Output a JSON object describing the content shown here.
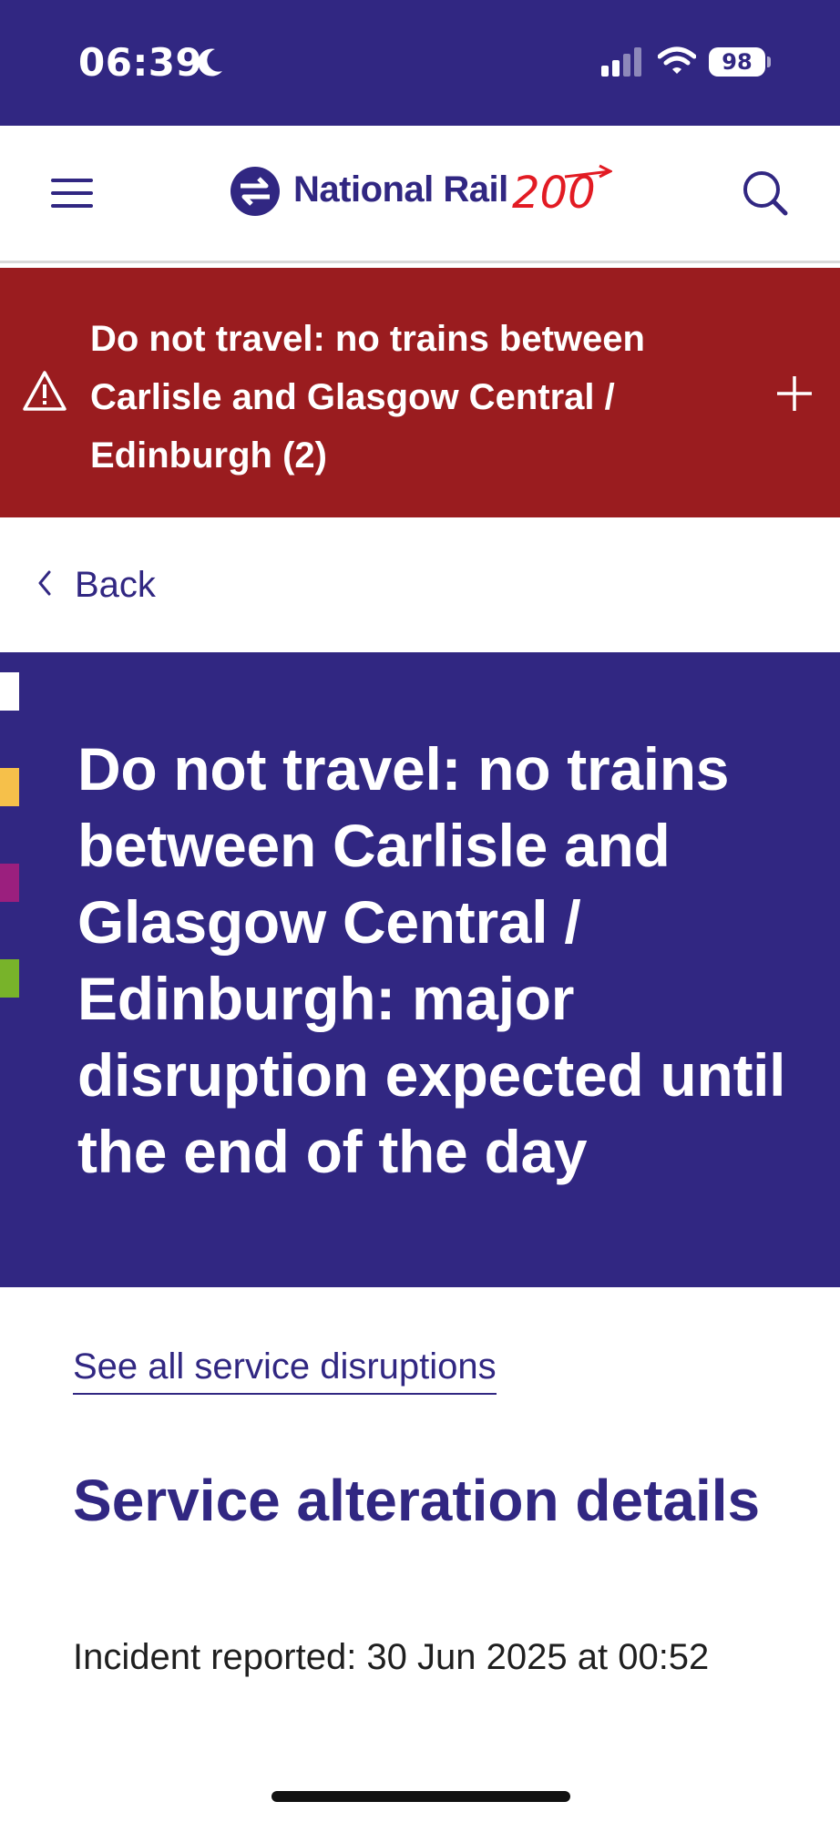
{
  "status_bar": {
    "time": "06:39",
    "battery": "98",
    "icons": [
      "moon-icon",
      "signal-icon",
      "wifi-icon",
      "battery-icon"
    ]
  },
  "header": {
    "logo_text": "National Rail",
    "logo_badge": "200",
    "icons": [
      "menu-icon",
      "national-rail-logo-icon",
      "search-icon"
    ]
  },
  "alert": {
    "text": "Do not travel: no trains between Carlisle and Glasgow Central / Edinburgh (2)",
    "icons": [
      "warning-icon",
      "plus-icon"
    ]
  },
  "nav": {
    "back_label": "Back"
  },
  "hero": {
    "title": "Do not travel: no trains between Carlisle and Glasgow Central / Edinburgh: major disruption expected until the end of the day",
    "stripe_colors": [
      "#ffffff",
      "#f6c04a",
      "#9b1f7e",
      "#78b32a"
    ]
  },
  "content": {
    "see_all_link": "See all service disruptions",
    "section_title": "Service alteration details",
    "incident_reported": "Incident reported: 30 Jun 2025 at 00:52"
  },
  "colors": {
    "brand_purple": "#312782",
    "alert_red": "#9a1c1f",
    "badge_red": "#e21b23"
  }
}
